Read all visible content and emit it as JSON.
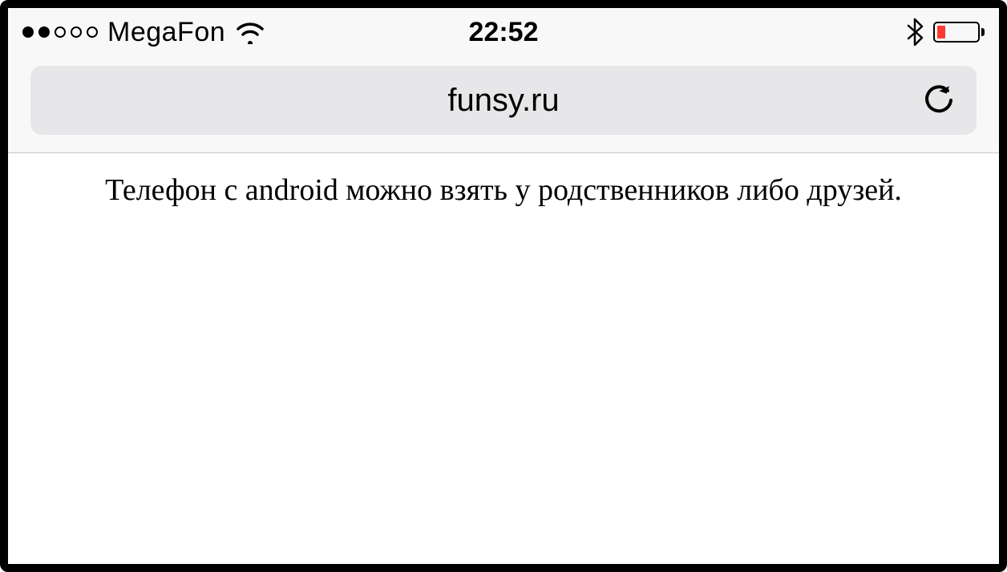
{
  "statusBar": {
    "signalFilled": 2,
    "signalTotal": 5,
    "carrier": "MegaFon",
    "time": "22:52"
  },
  "browser": {
    "url": "funsy.ru"
  },
  "page": {
    "text": "Телефон с android можно взять у родственников либо друзей."
  }
}
